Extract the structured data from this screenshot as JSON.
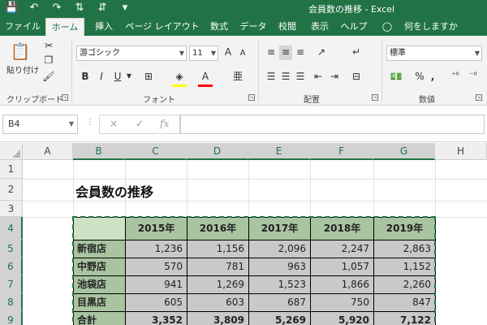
{
  "window": {
    "title": "会員数の推移 - Excel",
    "qat_icons": [
      "save-icon",
      "undo-icon",
      "redo-icon",
      "sort-asc-icon",
      "sort-desc-icon",
      "customize-icon"
    ]
  },
  "menu": {
    "tabs": [
      {
        "label": "ファイル"
      },
      {
        "label": "ホーム"
      },
      {
        "label": "挿入"
      },
      {
        "label": "ページ レイアウト"
      },
      {
        "label": "数式"
      },
      {
        "label": "データ"
      },
      {
        "label": "校閲"
      },
      {
        "label": "表示"
      },
      {
        "label": "ヘルプ"
      }
    ],
    "active_tab": "ホーム",
    "tellme": "何をしますか"
  },
  "ribbon": {
    "clipboard": {
      "label": "クリップボード",
      "paste_label": "貼り付け"
    },
    "font": {
      "label": "フォント",
      "font_name": "游ゴシック",
      "font_size": "11",
      "grow": "A",
      "shrink": "A",
      "bold": "B",
      "italic": "I",
      "underline": "U",
      "font_color": "A"
    },
    "alignment": {
      "label": "配置"
    },
    "number": {
      "label": "数値",
      "format": "標準",
      "percent": "%",
      "comma": ","
    }
  },
  "formula_bar": {
    "name_box": "B4",
    "cancel": "×",
    "enter": "✓",
    "fx": "fx",
    "content": ""
  },
  "sheet": {
    "columns": [
      "A",
      "B",
      "C",
      "D",
      "E",
      "F",
      "G",
      "H"
    ],
    "rows": [
      "1",
      "2",
      "3",
      "4",
      "5",
      "6",
      "7",
      "8",
      "9"
    ],
    "selected_columns": [
      "B",
      "C",
      "D",
      "E",
      "F",
      "G"
    ],
    "selected_rows": [
      "4",
      "5",
      "6",
      "7",
      "8",
      "9"
    ],
    "title": "会員数の推移",
    "table": {
      "header": [
        "",
        "2015年",
        "2016年",
        "2017年",
        "2018年",
        "2019年"
      ],
      "rows": [
        {
          "label": "新宿店",
          "values": [
            "1,236",
            "1,156",
            "2,096",
            "2,247",
            "2,863"
          ]
        },
        {
          "label": "中野店",
          "values": [
            "570",
            "781",
            "963",
            "1,057",
            "1,152"
          ]
        },
        {
          "label": "池袋店",
          "values": [
            "941",
            "1,269",
            "1,523",
            "1,866",
            "2,260"
          ]
        },
        {
          "label": "目黒店",
          "values": [
            "605",
            "603",
            "687",
            "750",
            "847"
          ]
        },
        {
          "label": "合計",
          "values": [
            "3,352",
            "3,809",
            "5,269",
            "5,920",
            "7,122"
          ]
        }
      ]
    },
    "colors": {
      "header_fill": "#a9c4a1",
      "value_fill": "#c9c9c9",
      "accent": "#217346"
    }
  }
}
